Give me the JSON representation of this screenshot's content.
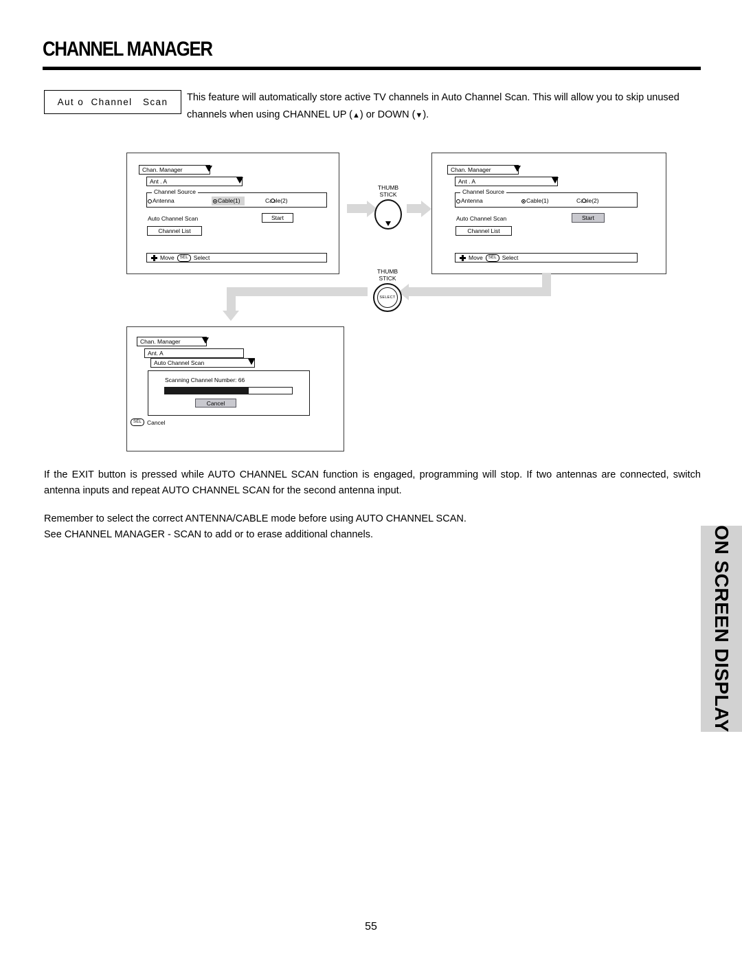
{
  "header": {
    "title": "CHANNEL MANAGER"
  },
  "intro": {
    "feature_label": "Aut o  Channel   Scan",
    "paragraph_part1": "This feature will automatically store active TV channels in Auto Channel Scan.  This will allow you to skip unused channels when using CHANNEL UP (",
    "up_arrow": "▲",
    "paragraph_part2": ") or DOWN (",
    "down_arrow": "▼",
    "paragraph_part3": ")."
  },
  "diagram": {
    "panel1": {
      "menu_title": "Chan. Manager",
      "antenna_select": "Ant .   A",
      "group_title": "Channel Source",
      "option_antenna": "Antenna",
      "option_cable1": "Cable(1)",
      "option_cable2": "Cable(2)",
      "scan_label": "Auto Channel Scan",
      "start_button": "Start",
      "channel_list_button": "Channel List",
      "foot_move": "Move",
      "foot_sel": "SEL",
      "foot_select": "Select"
    },
    "panel2": {
      "menu_title": "Chan. Manager",
      "antenna_select": "Ant .   A",
      "group_title": "Channel Source",
      "option_antenna": "Antenna",
      "option_cable1": "Cable(1)",
      "option_cable2": "Cable(2)",
      "scan_label": "Auto Channel Scan",
      "start_button": "Start",
      "channel_list_button": "Channel List",
      "foot_move": "Move",
      "foot_sel": "SEL",
      "foot_select": "Select"
    },
    "panel3": {
      "menu_title": "Chan. Manager",
      "antenna_select": "Ant. A",
      "scan_select": "Auto Channel Scan",
      "scanning_text": "Scanning Channel Number: 66",
      "progress_percent": 66,
      "cancel_button": "Cancel",
      "foot_sel": "SEL",
      "foot_cancel": "Cancel"
    },
    "thumbstick1": {
      "label": "THUMB\nSTICK"
    },
    "thumbstick2": {
      "label": "THUMB\nSTICK",
      "inner_label": "SELECT"
    }
  },
  "notes": {
    "note1": "If the EXIT button is pressed while AUTO CHANNEL SCAN function is engaged, programming will stop.  If two antennas are connected, switch antenna inputs and repeat AUTO CHANNEL SCAN for the second antenna input.",
    "note2_line1": "Remember to select the correct ANTENNA/CABLE mode before using AUTO CHANNEL SCAN.",
    "note2_line2": "See CHANNEL MANAGER - SCAN to add or to erase additional channels."
  },
  "sidebar": {
    "tab_label": "ON SCREEN DISPLAY",
    "tab_color": "#d2d2d2"
  },
  "footer": {
    "page_number": "55"
  }
}
